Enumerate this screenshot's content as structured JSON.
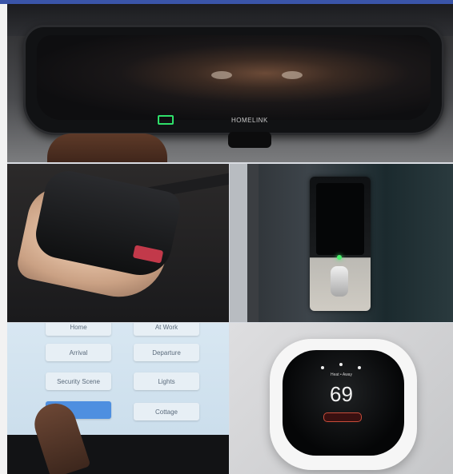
{
  "mirror_panel": {
    "brand_text": "HOMELINK"
  },
  "touch_panel": {
    "buttons": [
      "Home",
      "At Work",
      "Arrival",
      "Departure",
      "Security Scene",
      "Lights",
      "",
      "Cottage"
    ],
    "active_index": 6
  },
  "thermostat_panel": {
    "mode_text": "Heat • Away",
    "temperature": "69"
  }
}
